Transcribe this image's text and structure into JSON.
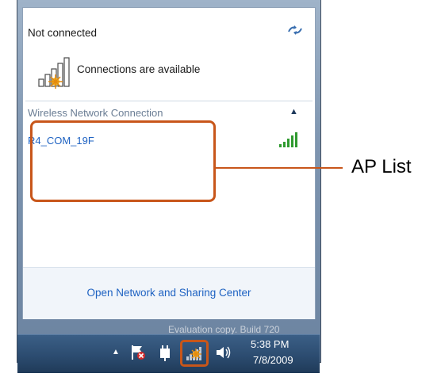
{
  "popup": {
    "status_title": "Not connected",
    "status_text": "Connections are available",
    "section_label": "Wireless Network Connection",
    "networks": [
      {
        "name": "R4_COM_19F",
        "signal": "full"
      }
    ],
    "footer_link": "Open Network and Sharing Center"
  },
  "watermark": "Evaluation copy. Build 720",
  "taskbar": {
    "time": "5:38 PM",
    "date": "7/8/2009"
  },
  "callout": {
    "label": "AP List"
  },
  "colors": {
    "accent": "#c8561a",
    "link": "#1e62c2",
    "signal": "#2f9a2f"
  },
  "icons": [
    "refresh-icon",
    "wireless-status-icon",
    "chevron-up-icon",
    "signal-strength-icon",
    "show-hidden-icons-icon",
    "action-center-flag-icon",
    "power-icon",
    "wireless-network-icon",
    "volume-icon"
  ]
}
